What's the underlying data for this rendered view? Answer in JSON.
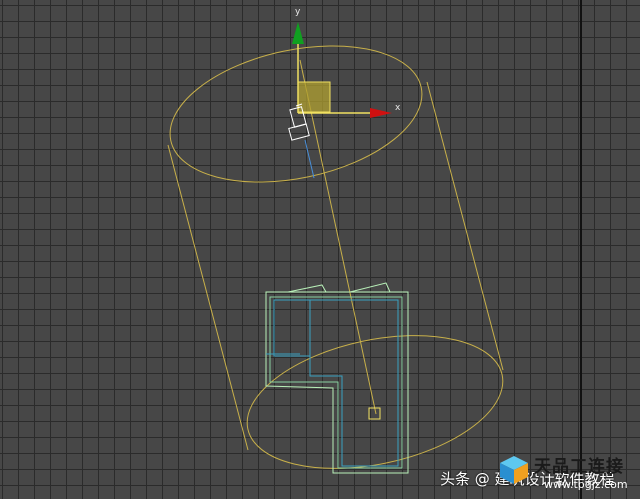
{
  "viewport": {
    "axis_y_label": "y",
    "axis_x_label": "x"
  },
  "watermark": {
    "source_text": "头条 @ 建筑设计软件教程",
    "brand_text": "天品工连接",
    "brand_url": "www.tpgjz.com"
  },
  "colors": {
    "grid_bg": "#474747",
    "grid_line": "#2b2b2b",
    "cylinder": "#c8b04a",
    "camera": "#ffffff",
    "target_line": "#4a90d9",
    "house_outer": "#b8f0b8",
    "house_inner": "#3aa0c0",
    "axis_x": "#d01010",
    "axis_y": "#10a020",
    "axis_plane": "#f0e060"
  }
}
